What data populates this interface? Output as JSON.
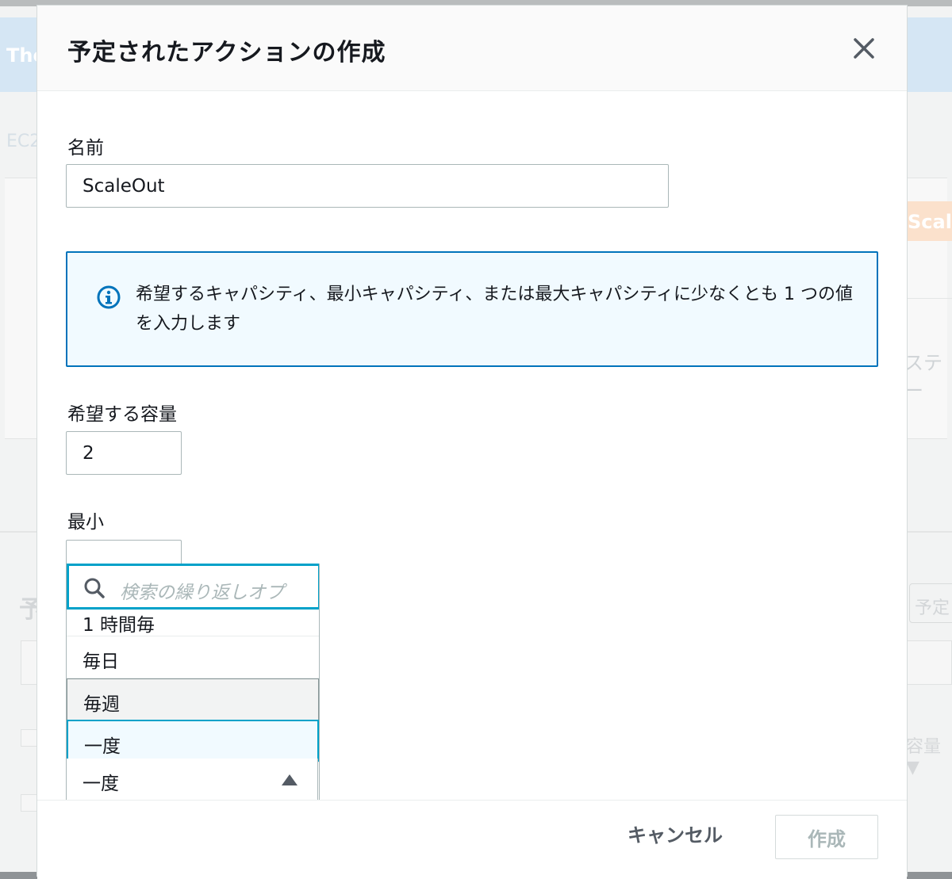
{
  "background": {
    "banner_text": "The",
    "breadcrumb_text": "EC2",
    "badge_text": "Scali",
    "status_text": "ステー",
    "section_title": "予",
    "section_button": "予定",
    "column_text": "容量 ▼"
  },
  "modal": {
    "title": "予定されたアクションの作成",
    "close_icon": "close-icon",
    "name_label": "名前",
    "name_value": "ScaleOut",
    "info_text": "希望するキャパシティ、最小キャパシティ、または最大キャパシティに少なくとも 1 つの値を入力します",
    "desired_label": "希望する容量",
    "desired_value": "2",
    "min_label": "最小",
    "min_value": "",
    "dropdown": {
      "search_placeholder": "検索の繰り返しオプ",
      "options": [
        {
          "label": "1 時間毎",
          "state": "partial"
        },
        {
          "label": "毎日",
          "state": "normal"
        },
        {
          "label": "毎週",
          "state": "hover"
        },
        {
          "label": "一度",
          "state": "selected"
        }
      ],
      "selected_value": "一度"
    },
    "footer": {
      "cancel_label": "キャンセル",
      "create_label": "作成"
    }
  },
  "colors": {
    "accent": "#00a1c9",
    "info_border": "#0073bb",
    "info_bg": "#f1faff"
  }
}
